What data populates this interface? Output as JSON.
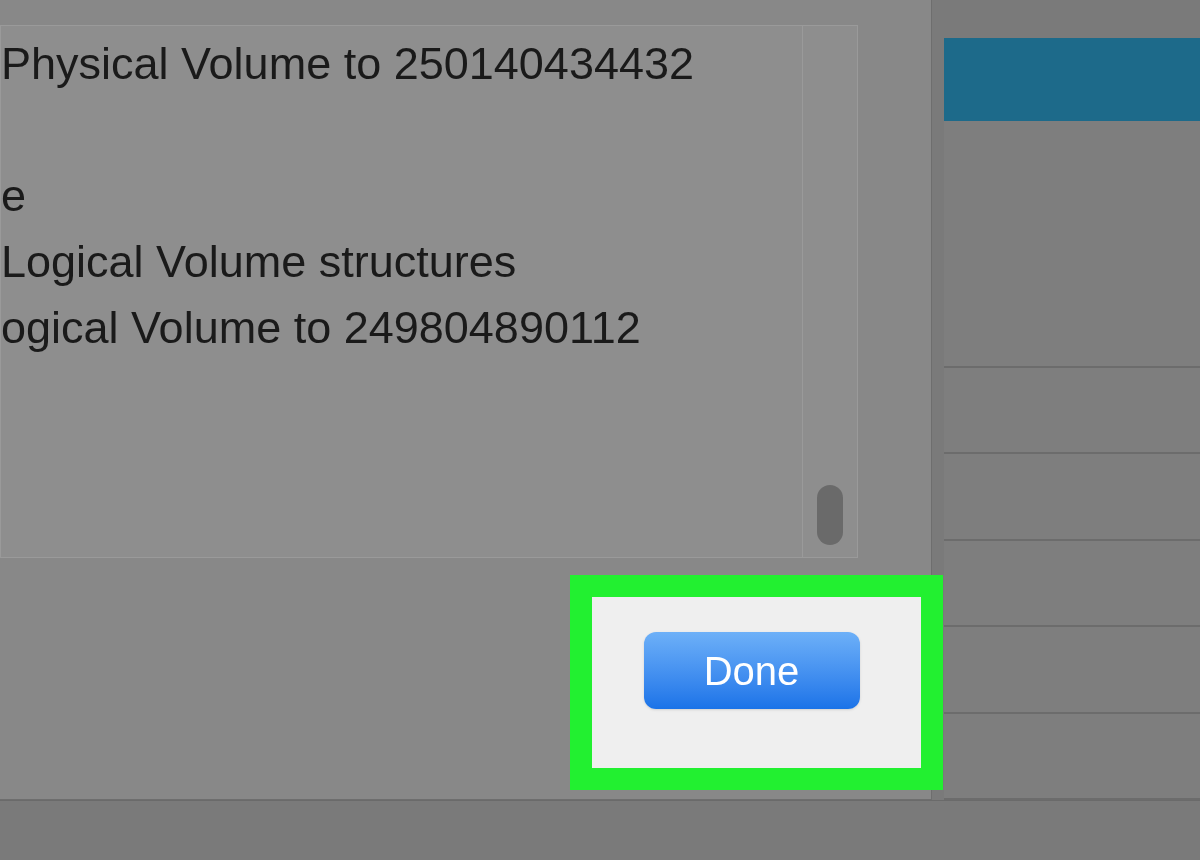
{
  "log": {
    "lines": [
      "Physical Volume to 250140434432",
      "e",
      "Logical Volume structures",
      "ogical Volume to 249804890112"
    ]
  },
  "done_button": {
    "label": "Done",
    "highlighted": true
  },
  "background_list": {
    "rows": [
      {
        "selected": true
      },
      {
        "selected": false
      },
      {
        "selected": false
      },
      {
        "selected": false
      },
      {
        "selected": false
      },
      {
        "selected": false
      },
      {
        "selected": false
      }
    ]
  }
}
